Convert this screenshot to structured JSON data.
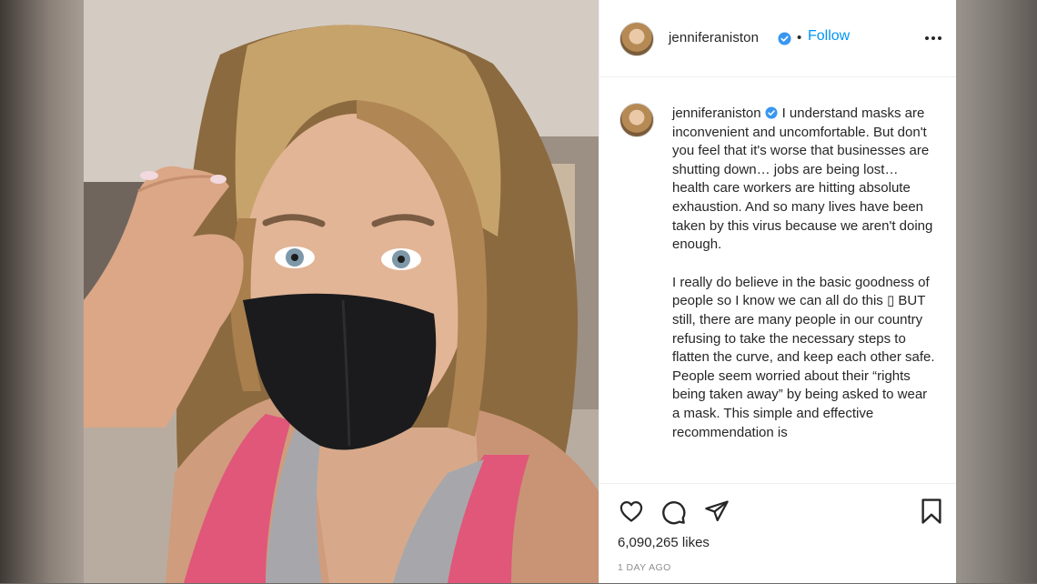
{
  "post": {
    "username": "jenniferaniston",
    "follow_label": "Follow",
    "separator": "•",
    "caption_username": "jenniferaniston",
    "caption_paragraphs": [
      "I understand masks are inconvenient and uncomfortable. But don't you feel that it's worse that businesses are shutting down… jobs are being lost… health care workers are hitting absolute exhaustion. And so many lives have been taken by this virus because we aren't doing enough.",
      "I really do believe in the basic goodness of people so I know we can all do this ▯ BUT still, there are many people in our country refusing to take the necessary steps to flatten the curve, and keep each other safe. People seem worried about their “rights being taken away” by being asked to wear a mask. This simple and effective recommendation is"
    ],
    "likes": "6,090,265 likes",
    "timestamp": "1 DAY AGO"
  },
  "icons": {
    "verified": "verified-badge-icon",
    "more": "more-options-icon",
    "like": "heart-icon",
    "comment": "comment-icon",
    "share": "share-icon",
    "save": "bookmark-icon"
  },
  "colors": {
    "follow": "#0095f6",
    "verified": "#3897f0",
    "text": "#262626",
    "muted": "#8e8e8e"
  }
}
